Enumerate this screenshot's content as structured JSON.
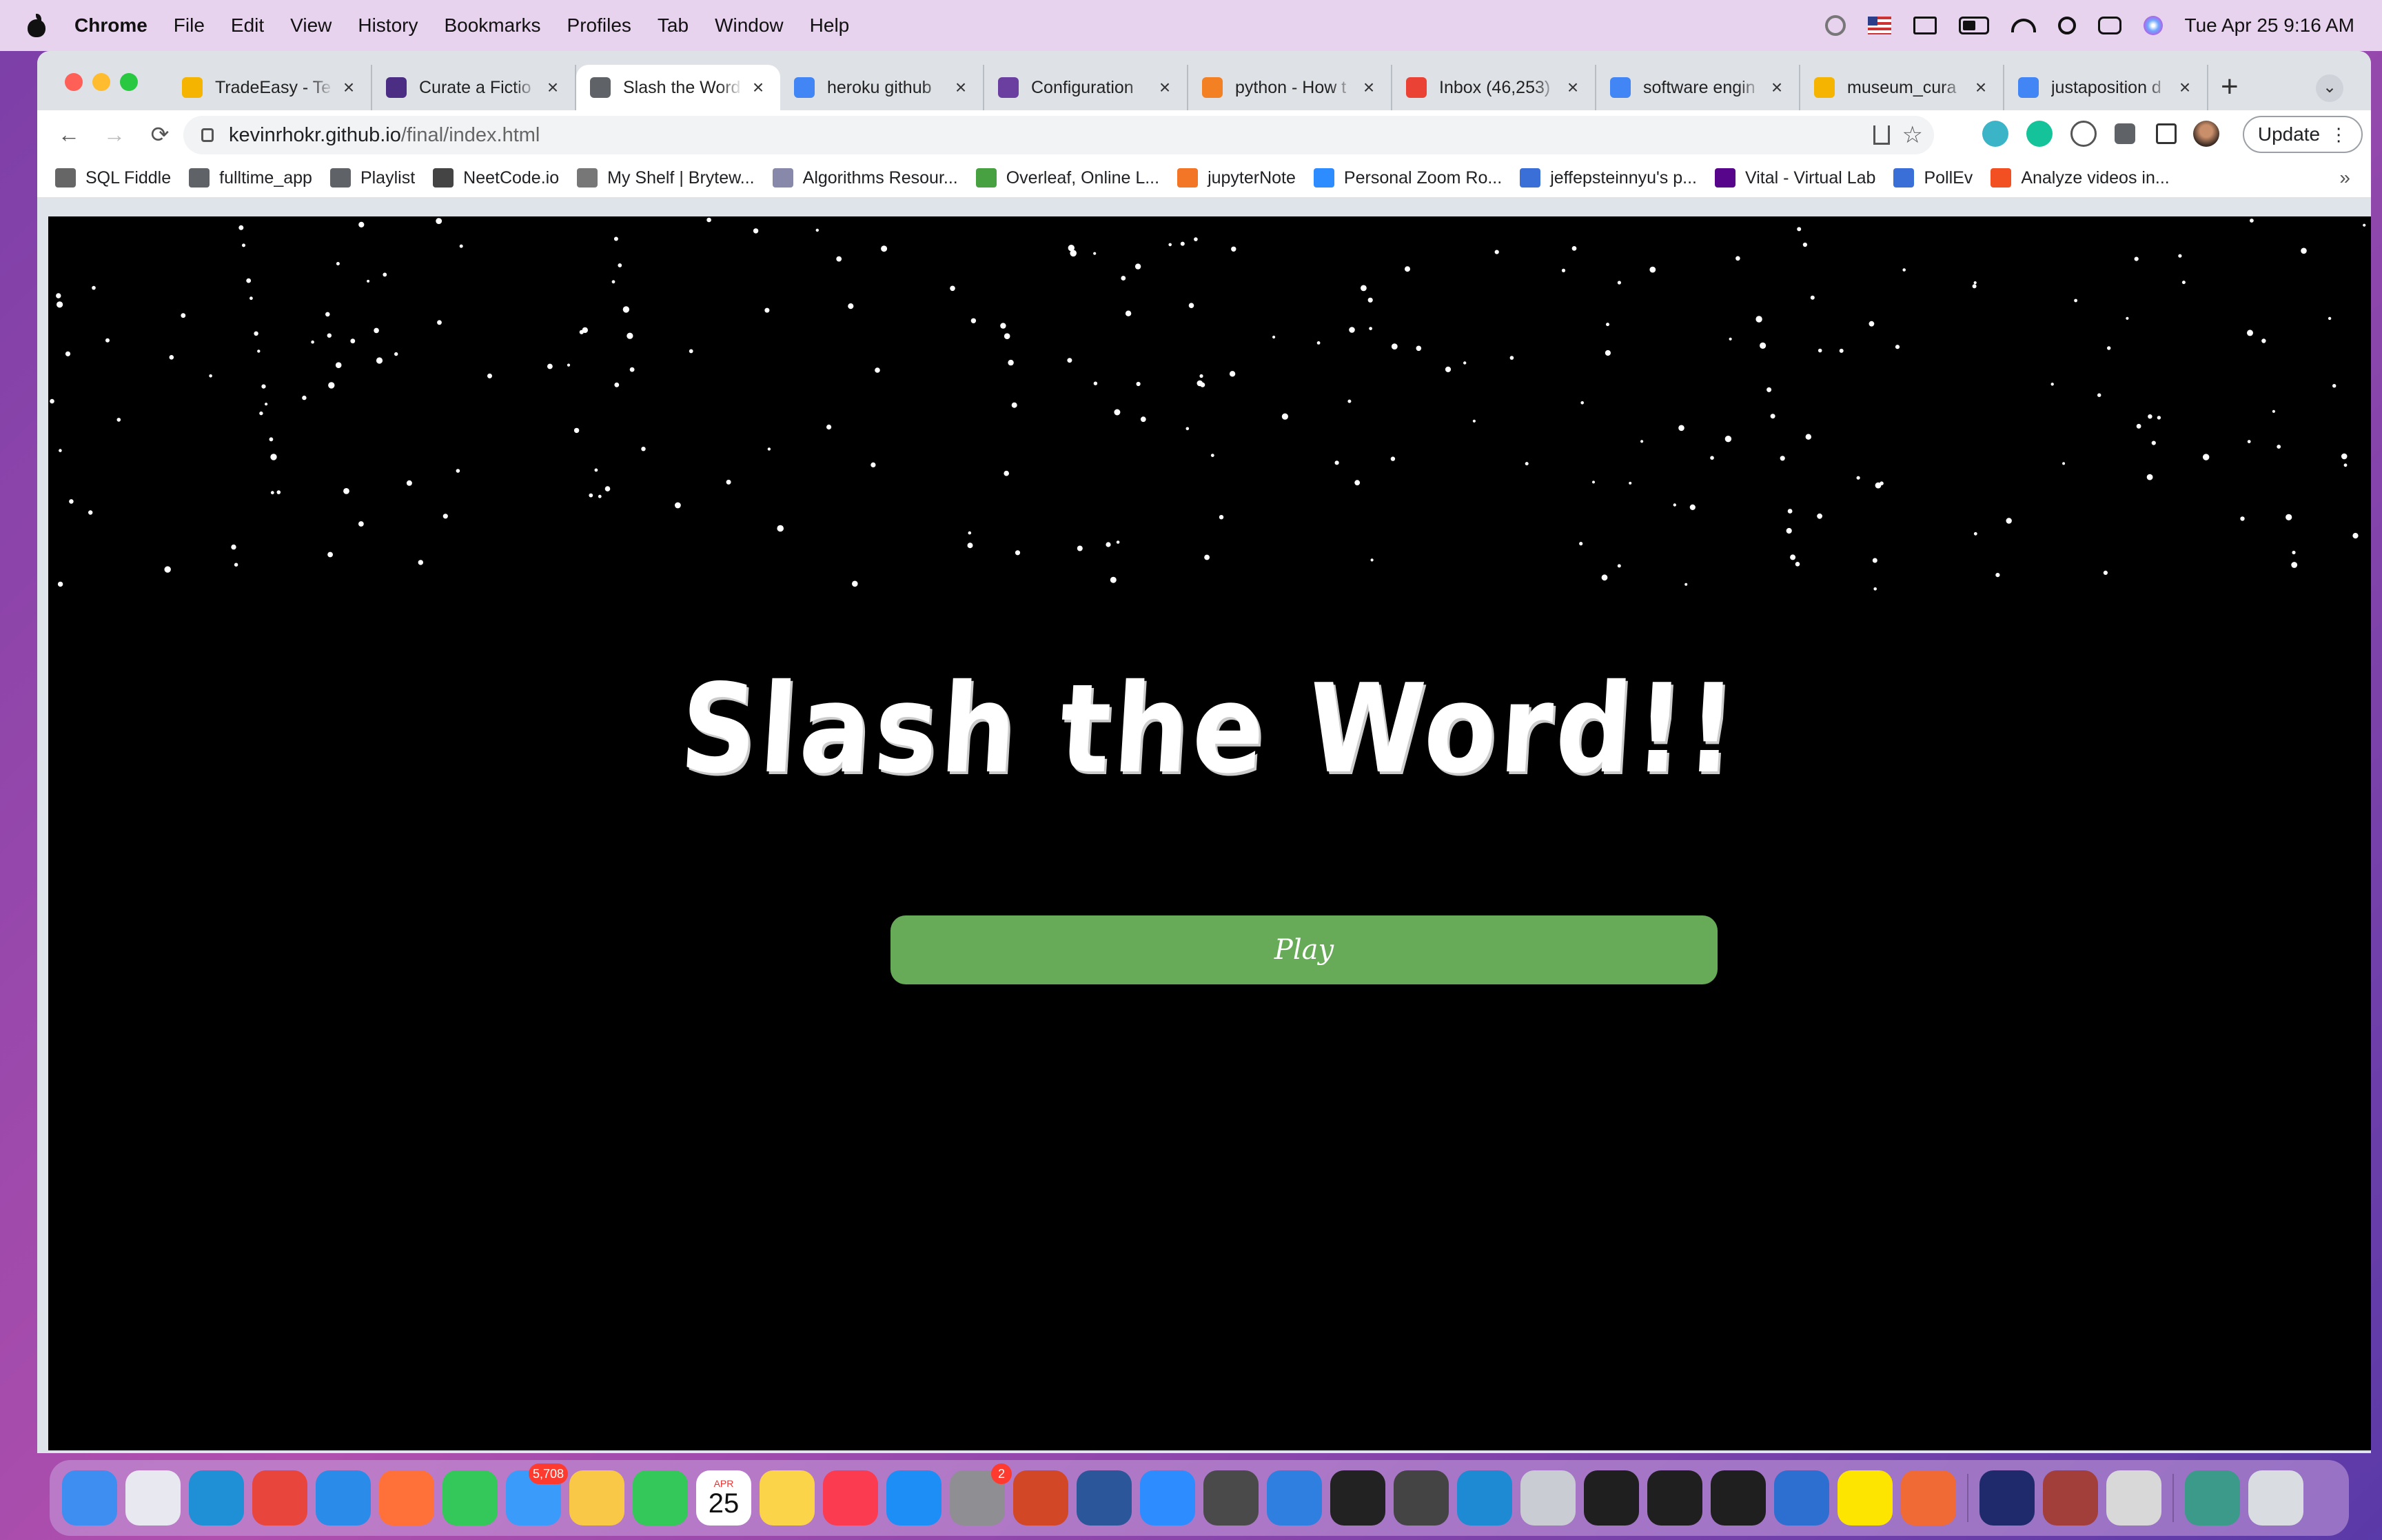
{
  "menubar": {
    "app_name": "Chrome",
    "items": [
      "File",
      "Edit",
      "View",
      "History",
      "Bookmarks",
      "Profiles",
      "Tab",
      "Window",
      "Help"
    ],
    "clock": "Tue Apr 25  9:16 AM"
  },
  "browser": {
    "tabs": [
      {
        "title": "TradeEasy - Te",
        "favicon_color": "#f4b400"
      },
      {
        "title": "Curate a Fictio",
        "favicon_color": "#4b2e83"
      },
      {
        "title": "Slash the Word",
        "favicon_color": "#5f6368",
        "active": true
      },
      {
        "title": "heroku github",
        "favicon_color": "#4285f4"
      },
      {
        "title": "Configuration",
        "favicon_color": "#6b3fa0"
      },
      {
        "title": "python - How t",
        "favicon_color": "#f48024"
      },
      {
        "title": "Inbox (46,253)",
        "favicon_color": "#ea4335"
      },
      {
        "title": "software engin",
        "favicon_color": "#4285f4"
      },
      {
        "title": "museum_cura",
        "favicon_color": "#f4b400"
      },
      {
        "title": "justaposition d",
        "favicon_color": "#4285f4"
      }
    ],
    "url_host": "kevinrhokr.github.io",
    "url_path": "/final/index.html",
    "update_label": "Update",
    "bookmarks": [
      {
        "label": "SQL Fiddle",
        "icon_color": "#666666"
      },
      {
        "label": "fulltime_app",
        "icon_color": "#5f6368"
      },
      {
        "label": "Playlist",
        "icon_color": "#5f6368"
      },
      {
        "label": "NeetCode.io",
        "icon_color": "#444444"
      },
      {
        "label": "My Shelf | Brytew...",
        "icon_color": "#777777"
      },
      {
        "label": "Algorithms Resour...",
        "icon_color": "#8888aa"
      },
      {
        "label": "Overleaf, Online L...",
        "icon_color": "#47a141"
      },
      {
        "label": "jupyterNote",
        "icon_color": "#f37626"
      },
      {
        "label": "Personal Zoom Ro...",
        "icon_color": "#2d8cff"
      },
      {
        "label": "jeffepsteinnyu's p...",
        "icon_color": "#3b6fd8"
      },
      {
        "label": "Vital - Virtual Lab",
        "icon_color": "#57068c"
      },
      {
        "label": "PollEv",
        "icon_color": "#3b6fd8"
      },
      {
        "label": "Analyze videos in...",
        "icon_color": "#f25022"
      }
    ]
  },
  "page": {
    "title": "Slash the Word!!",
    "play_label": "Play",
    "play_color": "#67ab58",
    "background_color": "#000000"
  },
  "dock": {
    "apps": [
      {
        "name": "finder-icon",
        "color": "#3d8ef0"
      },
      {
        "name": "launchpad-icon",
        "color": "#e8e8f0"
      },
      {
        "name": "edge-icon",
        "color": "#1f8fd6"
      },
      {
        "name": "chrome-icon",
        "color": "#e8453c"
      },
      {
        "name": "safari-icon",
        "color": "#2a8be8"
      },
      {
        "name": "firefox-icon",
        "color": "#ff7139"
      },
      {
        "name": "messages-icon",
        "color": "#34c759"
      },
      {
        "name": "mail-icon",
        "color": "#3a9bfa",
        "badge": "5,708"
      },
      {
        "name": "photos-icon",
        "color": "#f8c846"
      },
      {
        "name": "facetime-icon",
        "color": "#34c759"
      },
      {
        "name": "calendar-icon",
        "calendar": true,
        "month": "APR",
        "day": "25"
      },
      {
        "name": "notes-icon",
        "color": "#fbd44a"
      },
      {
        "name": "music-icon",
        "color": "#fa3b50"
      },
      {
        "name": "app-store-icon",
        "color": "#1e8ef7"
      },
      {
        "name": "system-settings-icon",
        "color": "#8e8e93",
        "badge": "2"
      },
      {
        "name": "powerpoint-icon",
        "color": "#d24726"
      },
      {
        "name": "word-icon",
        "color": "#2b579a"
      },
      {
        "name": "zoom-icon",
        "color": "#2d8cff"
      },
      {
        "name": "sublime-icon",
        "color": "#4a4a4a"
      },
      {
        "name": "xcode-icon",
        "color": "#2f7fe0"
      },
      {
        "name": "terminal-icon",
        "color": "#222222"
      },
      {
        "name": "sublime-merge-icon",
        "color": "#444444"
      },
      {
        "name": "vscode-icon",
        "color": "#1f8ad4"
      },
      {
        "name": "box-icon",
        "color": "#c9cdd3"
      },
      {
        "name": "pycharm-icon",
        "color": "#1f1f1f"
      },
      {
        "name": "intellij-icon",
        "color": "#1f1f1f"
      },
      {
        "name": "goland-icon",
        "color": "#1f1f1f"
      },
      {
        "name": "wireshark-icon",
        "color": "#2d6fd1"
      },
      {
        "name": "kakaotalk-icon",
        "color": "#fee500"
      },
      {
        "name": "pencil-app-icon",
        "color": "#f06a35"
      },
      {
        "name": "separator"
      },
      {
        "name": "webex-icon",
        "color": "#1e2a6b"
      },
      {
        "name": "dictionary-icon",
        "color": "#a33f3a"
      },
      {
        "name": "gimp-icon",
        "color": "#d8d8d8"
      },
      {
        "name": "separator"
      },
      {
        "name": "downloads-icon",
        "color": "#3c9a8a"
      },
      {
        "name": "trash-icon",
        "color": "#d9dde2"
      }
    ]
  }
}
